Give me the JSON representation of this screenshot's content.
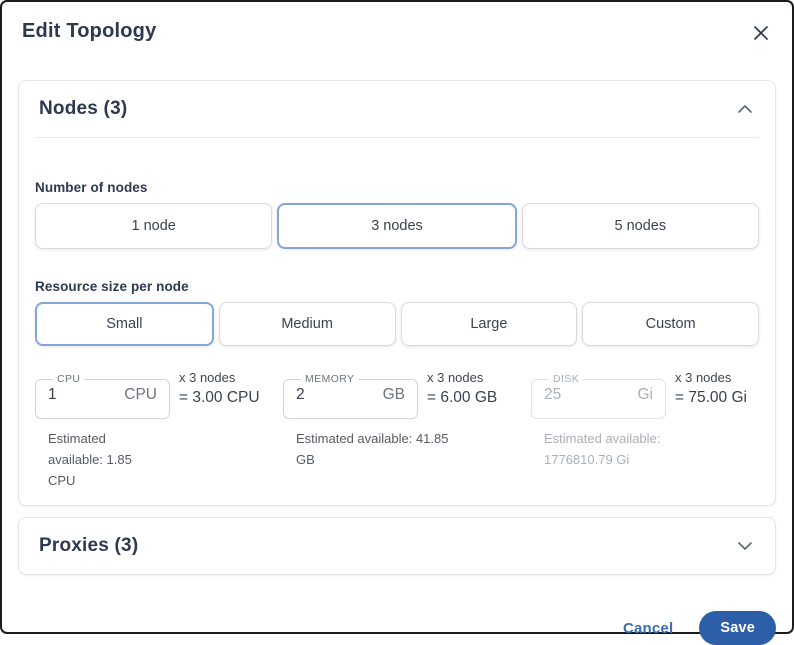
{
  "modal": {
    "title": "Edit Topology"
  },
  "nodes_section": {
    "title": "Nodes (3)",
    "number_label": "Number of nodes",
    "node_options": [
      {
        "label": "1 node",
        "selected": false
      },
      {
        "label": "3 nodes",
        "selected": true
      },
      {
        "label": "5 nodes",
        "selected": false
      }
    ],
    "size_label": "Resource size per node",
    "size_options": [
      {
        "label": "Small",
        "selected": true
      },
      {
        "label": "Medium",
        "selected": false
      },
      {
        "label": "Large",
        "selected": false
      },
      {
        "label": "Custom",
        "selected": false
      }
    ],
    "resources": [
      {
        "label": "CPU",
        "value": "1",
        "unit": "CPU",
        "multiplier": "x 3 nodes",
        "total": "= 3.00 CPU",
        "estimated": "Estimated available: 1.85 CPU",
        "disabled": false
      },
      {
        "label": "MEMORY",
        "value": "2",
        "unit": "GB",
        "multiplier": "x 3 nodes",
        "total": "= 6.00 GB",
        "estimated": "Estimated available: 41.85 GB",
        "disabled": false
      },
      {
        "label": "DISK",
        "value": "25",
        "unit": "Gi",
        "multiplier": "x 3 nodes",
        "total": "= 75.00 Gi",
        "estimated": "Estimated available: 1776810.79 Gi",
        "disabled": true
      }
    ]
  },
  "proxies_section": {
    "title": "Proxies (3)"
  },
  "footer": {
    "cancel_label": "Cancel",
    "save_label": "Save"
  },
  "colors": {
    "accent_selected_border": "#85a6db",
    "save_button": "#2d5fa8",
    "cancel_link": "#3e6cb0",
    "heading_text": "#2e3950"
  }
}
